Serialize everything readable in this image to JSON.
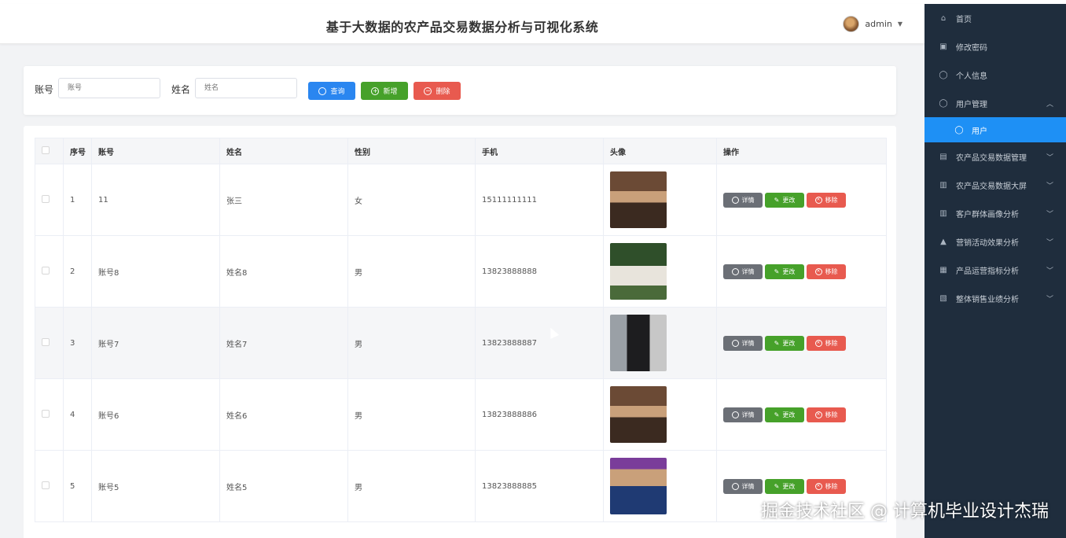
{
  "header": {
    "title": "基于大数据的农产品交易数据分析与可视化系统",
    "user": "admin",
    "caret": "▼"
  },
  "search": {
    "account_label": "账号",
    "account_placeholder": "账号",
    "name_label": "姓名",
    "name_placeholder": "姓名",
    "query_btn": "查询",
    "add_btn": "新增",
    "delete_btn": "删除"
  },
  "table": {
    "columns": [
      "序号",
      "账号",
      "姓名",
      "性别",
      "手机",
      "头像",
      "操作"
    ],
    "rows": [
      {
        "no": "1",
        "account": "11",
        "name": "张三",
        "gender": "女",
        "phone": "15111111111"
      },
      {
        "no": "2",
        "account": "账号8",
        "name": "姓名8",
        "gender": "男",
        "phone": "13823888888"
      },
      {
        "no": "3",
        "account": "账号7",
        "name": "姓名7",
        "gender": "男",
        "phone": "13823888887"
      },
      {
        "no": "4",
        "account": "账号6",
        "name": "姓名6",
        "gender": "男",
        "phone": "13823888886"
      },
      {
        "no": "5",
        "account": "账号5",
        "name": "姓名5",
        "gender": "男",
        "phone": "13823888885"
      }
    ],
    "ops": {
      "detail": "详情",
      "edit": "更改",
      "remove": "移除"
    }
  },
  "sidebar": {
    "items": [
      {
        "label": "首页",
        "icon": "home-icon"
      },
      {
        "label": "修改密码",
        "icon": "lock-icon"
      },
      {
        "label": "个人信息",
        "icon": "user-icon"
      },
      {
        "label": "用户管理",
        "icon": "user-icon",
        "arrow": "up"
      },
      {
        "label": "用户",
        "icon": "user-icon",
        "active": true
      },
      {
        "label": "农产品交易数据管理",
        "icon": "doc-icon",
        "arrow": "down"
      },
      {
        "label": "农产品交易数据大屏",
        "icon": "bar-chart-icon",
        "arrow": "down"
      },
      {
        "label": "客户群体画像分析",
        "icon": "bar-chart-icon",
        "arrow": "down"
      },
      {
        "label": "营销活动效果分析",
        "icon": "bag-icon",
        "arrow": "down"
      },
      {
        "label": "产品运营指标分析",
        "icon": "grid-icon",
        "arrow": "down"
      },
      {
        "label": "整体销售业绩分析",
        "icon": "chart-box-icon",
        "arrow": "down"
      }
    ]
  },
  "watermark": "掘金技术社区 @ 计算机毕业设计杰瑞",
  "colors": {
    "primary": "#2a86f0",
    "success": "#46a12a",
    "danger": "#e85a4f",
    "sidebar": "#1f2d3d",
    "active": "#1e90f5"
  }
}
